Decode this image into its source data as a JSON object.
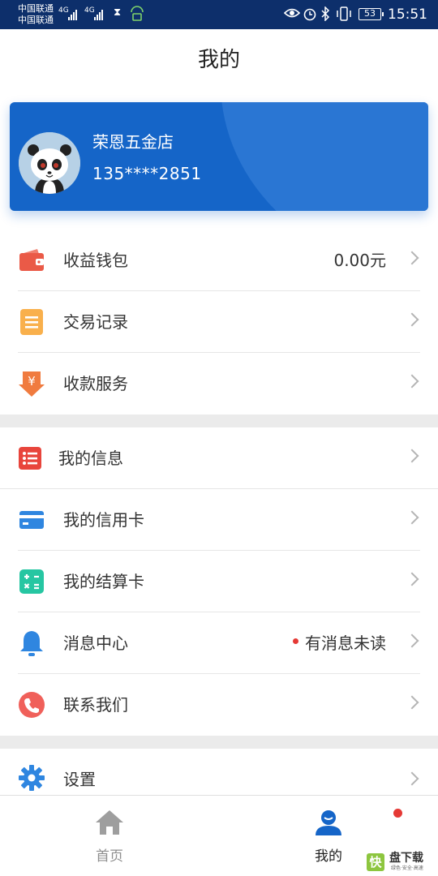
{
  "status_bar": {
    "carrier_1": "中国联通",
    "carrier_2": "中国联通",
    "network_1": "4G",
    "network_2": "4G",
    "battery": "53",
    "time": "15:51",
    "icons": [
      "hourglass-icon",
      "lock-wifi-icon",
      "eye-icon",
      "alarm-icon",
      "bluetooth-icon",
      "vibrate-icon"
    ]
  },
  "header": {
    "title": "我的"
  },
  "profile": {
    "shop_name": "荣恩五金店",
    "phone": "135****2851",
    "card_color": "#1565c8"
  },
  "menu_group_1": [
    {
      "label": "收益钱包",
      "value": "0.00元",
      "icon": "wallet-icon"
    },
    {
      "label": "交易记录",
      "icon": "document-icon"
    },
    {
      "label": "收款服务",
      "icon": "yuan-arrow-icon"
    }
  ],
  "menu_group_2": [
    {
      "label": "我的信息",
      "icon": "list-icon"
    },
    {
      "label": "我的信用卡",
      "icon": "credit-card-icon"
    },
    {
      "label": "我的结算卡",
      "icon": "calculator-icon"
    },
    {
      "label": "消息中心",
      "value": "有消息未读",
      "icon": "bell-icon"
    },
    {
      "label": "联系我们",
      "icon": "phone-icon"
    }
  ],
  "menu_group_3": [
    {
      "label": "设置",
      "icon": "gear-icon"
    }
  ],
  "tab_bar": {
    "tabs": [
      {
        "label": "首页",
        "icon": "home-icon",
        "active": false
      },
      {
        "label": "我的",
        "icon": "user-icon",
        "active": true
      }
    ],
    "accent": "#1565c8"
  },
  "watermark": {
    "logo": "快",
    "text": "盘下载",
    "sub": "绿色·安全·高速"
  }
}
